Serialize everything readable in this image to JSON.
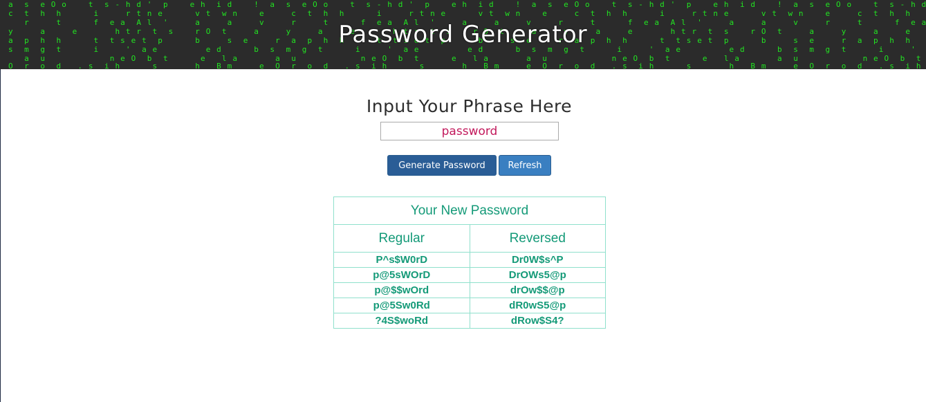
{
  "banner": {
    "title": "Password Generator",
    "rain_color": "#22e322",
    "rain_lines": [
      "a  s  e O o    t  s - h d '  p    e h  i d    !  a  s  e O o    t  s - h d '  p    e h  i d    !  a  s  e O o    t  s - h d '  p    e h  i d    !  a  s  e O o    t  s - h d '  p    e h  i d    !  a  s  e O o    t",
      "c  t  h  h      i     r t n e      v t  w n    e     c  t  h  h      i     r t n e      v t  w n    e     c  t  h  h      i     r t n e      v t  w n    e     c  t  h  h      i     r t n e      v t  w n    e     c",
      "   r     t      f  e a  A l  '     a     a     v     r     t      f  e a  A l  '     a     a     v     r     t      f  e a  A l  '     a     a     v     r     t      f  e a  A l  '     a     a     v     r     t",
      "y     a     e       h t r  t  s    r O  t     a     y     a     e       h t r  t  s    r O  t     a     y     a     e       h t r  t  s    r O  t     a     y     a     e       h t r  t  s    r O  t     a     y",
      "a  p  h  h      t  t s e t  p      b     s  e     r  a  p  h  h      t  t s e t  p      b     s  e     r  a  p  h  h      t  t s e t  p      b     s  e     r  a  p  h  h      t  t s e t  p      b     s  e     r",
      "s  m  g  t      i     '  a e         e d      b  s  m  g  t      i     '  a e         e d      b  s  m  g  t      i     '  a e         e d      b  s  m  g  t      i     '  a e         e d      b  s  m  g  t",
      "   a  u            n e O  b  t      e   l a       a  u            n e O  b  t      e   l a       a  u            n e O  b  t      e   l a       a  u            n e O  b  t      e   l a       a  u",
      "O  r  o  d   . s  i h      s       h   B m     e  O  r  o  d   . s  i h      s       h   B m     e  O  r  o  d   . s  i h      s       h   B m     e  O  r  o  d   . s  i h      s       h   B m     e  O"
    ]
  },
  "form": {
    "heading": "Input Your Phrase Here",
    "phrase_value": "password",
    "generate_label": "Generate Password",
    "refresh_label": "Refresh"
  },
  "results": {
    "title": "Your New Password",
    "columns": [
      "Regular",
      "Reversed"
    ],
    "rows": [
      [
        "P^s$W0rD",
        "Dr0W$s^P"
      ],
      [
        "p@5sWOrD",
        "DrOWs5@p"
      ],
      [
        "p@$$wOrd",
        "drOw$$@p"
      ],
      [
        "p@5Sw0Rd",
        "dR0wS5@p"
      ],
      [
        "?4S$woRd",
        "dRow$S4?"
      ]
    ],
    "text_color": "#149a78",
    "border_color": "#8fe0cc"
  }
}
